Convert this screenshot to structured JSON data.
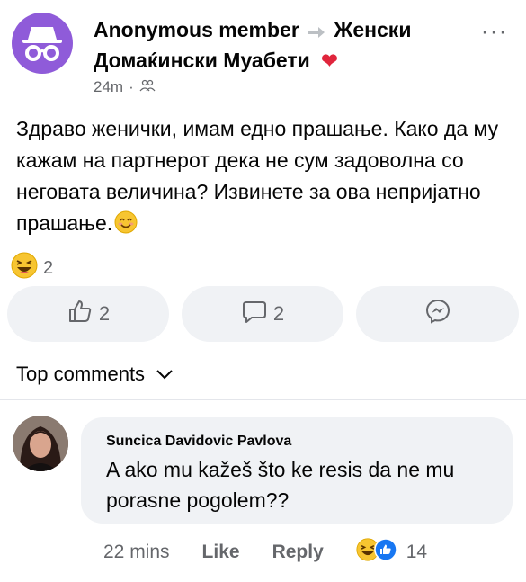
{
  "post": {
    "author": "Anonymous member",
    "group_line1": "Женски",
    "group_line2": "Домаќински Муабети",
    "heart_emoji": "❤",
    "time": "24m",
    "dot": "·",
    "more": "···",
    "body": "Здраво женички, имам едно прашање. Како да му кажам на партнерот дека не сум задоволна со неговата величина? Извинете за ова непријатно прашање.",
    "reaction_count": "2",
    "like_count": "2",
    "comment_count": "2"
  },
  "top_comments": {
    "label": "Top comments"
  },
  "comment": {
    "author": "Suncica Davidovic Pavlova",
    "text": "A ako mu kažeš što ke resis da ne mu porasne pogolem??",
    "time": "22 mins",
    "like_label": "Like",
    "reply_label": "Reply",
    "reaction_count": "14"
  },
  "colors": {
    "anon_avatar": "#8f5bd9",
    "bubble": "#f0f2f5",
    "secondary_text": "#65676b",
    "like_blue": "#1877f2",
    "heart": "#e0253c"
  },
  "icons": {
    "anon": "incognito-icon",
    "audience": "group-audience-icon",
    "like": "thumbs-up-icon",
    "comment": "comment-bubble-icon",
    "share": "messenger-icon",
    "chevron": "chevron-down-icon",
    "laugh": "laughing-emoji-icon",
    "smile": "smiling-emoji-icon"
  }
}
